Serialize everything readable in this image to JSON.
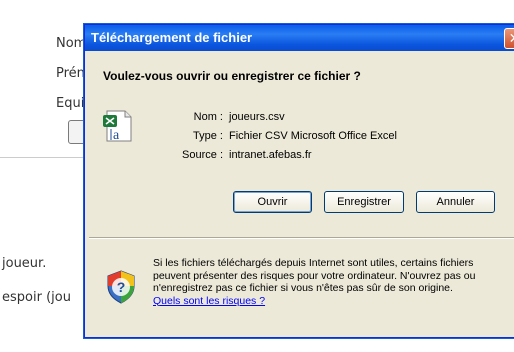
{
  "background_page": {
    "labels": [
      "Nom",
      "Prén",
      "Equi",
      "joueur.",
      "espoir (jou"
    ]
  },
  "dialog": {
    "title": "Téléchargement de fichier",
    "close_glyph": "✕",
    "question": "Voulez-vous ouvrir ou enregistrer ce fichier ?",
    "file_icon": "excel-csv-icon",
    "info": {
      "name_label": "Nom :",
      "name_value": "joueurs.csv",
      "type_label": "Type :",
      "type_value": "Fichier CSV Microsoft Office Excel",
      "source_label": "Source :",
      "source_value": "intranet.afebas.fr"
    },
    "buttons": {
      "open": "Ouvrir",
      "save": "Enregistrer",
      "cancel": "Annuler"
    },
    "warning_icon": "security-shield-icon",
    "warning_text": "Si les fichiers téléchargés depuis Internet sont utiles, certains fichiers peuvent présenter des risques pour votre ordinateur. N'ouvrez pas ou n'enregistrez pas ce fichier si vous n'êtes pas sûr de son origine.",
    "warning_link": "Quels sont les risques ?"
  },
  "colors": {
    "titlebar": "#0a5ee8",
    "dialog_bg": "#ece9d8",
    "close_button": "#d0502c",
    "link": "#0000ff"
  }
}
